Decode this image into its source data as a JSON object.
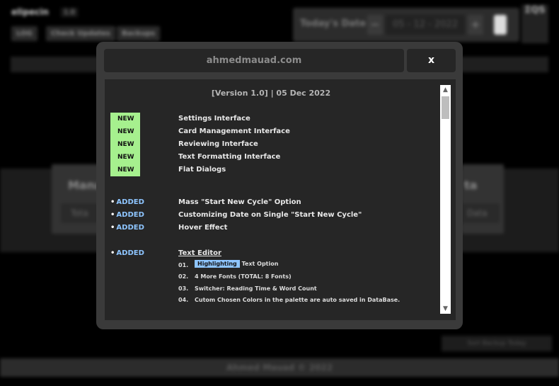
{
  "background_app": {
    "app_name": "elipecin",
    "version": "1.0",
    "toolbar_buttons": [
      "LOG",
      "Check Updates",
      "Backups"
    ],
    "date_label": "Today's Date",
    "date_value": "05 - 12 - 2022",
    "minus": "−",
    "plus": "+",
    "logo_text": "ΣQS",
    "left_card_title": "Mana",
    "left_card_input": "Tota",
    "right_card_title": "ta",
    "right_card_input": "Data",
    "lower_button": "Sort Backup Today",
    "footer": "Ahmed Mauad © 2022"
  },
  "modal": {
    "title": "ahmedmauad.com",
    "close_label": "x",
    "version_line": "[Version 1.0]  |  05 Dec 2022",
    "new_badge": "NEW",
    "new_items": [
      "Settings Interface",
      "Card Management Interface",
      "Reviewing Interface",
      "Text Formatting Interface",
      "Flat Dialogs"
    ],
    "added_tag": "ADDED",
    "bullet": "•",
    "added_items": [
      "Mass \"Start New Cycle\" Option",
      "Customizing Date on Single \"Start New Cycle\"",
      "Hover Effect"
    ],
    "text_editor": {
      "label": "Text Editor",
      "items": [
        {
          "num": "01.",
          "highlight": "Highlighting",
          "text": "Text Option"
        },
        {
          "num": "02.",
          "text": "4 More Fonts (TOTAL: 8 Fonts)"
        },
        {
          "num": "03.",
          "text": "Switcher: Reading Time & Word Count"
        },
        {
          "num": "04.",
          "text": "Cutom Chosen Colors in the palette are auto saved in DataBase."
        }
      ]
    },
    "scroll_up": "▲",
    "scroll_down": "▼"
  },
  "colors": {
    "new_badge": "#a6f08e",
    "added_text": "#8ec5ff",
    "highlight": "#8ec5ff",
    "modal_bg": "#3a3a3a",
    "panel_bg": "#262626"
  }
}
